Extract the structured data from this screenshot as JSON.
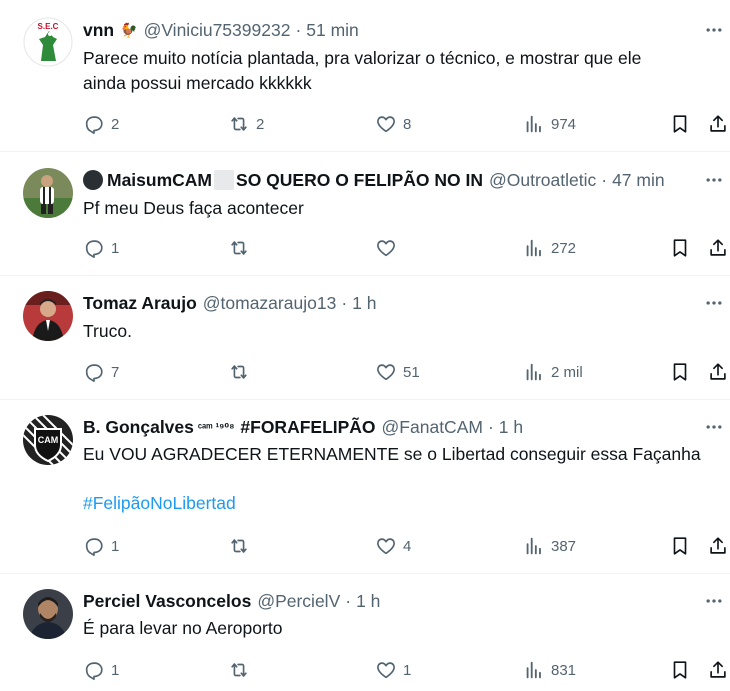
{
  "tweets": [
    {
      "name": "vnn",
      "handle": "@Viniciu75399232",
      "time": "51 min",
      "text": "Parece muito notícia plantada, pra valorizar o técnico, e mostrar que ele\nainda possui mercado kkkkkk",
      "counts": {
        "reply": "2",
        "retweet": "2",
        "like": "8",
        "views": "974"
      },
      "avatar_text": "S.E.C"
    },
    {
      "name": "MaisumCAM",
      "name_rest": "SO QUERO O FELIPÃO NO IN",
      "handle": "@Outroatletic",
      "time": "47 min",
      "text": "Pf meu Deus faça acontecer",
      "counts": {
        "reply": "1",
        "retweet": "",
        "like": "",
        "views": "272"
      }
    },
    {
      "name": "Tomaz Araujo",
      "handle": "@tomazaraujo13",
      "time": "1 h",
      "text": "Truco.",
      "counts": {
        "reply": "7",
        "retweet": "",
        "like": "51",
        "views": "2 mil"
      }
    },
    {
      "name": "B. Gonçalves",
      "name_sup": "ᶜᵃᵐ ¹⁹⁰⁸",
      "name_tag": "#FORAFELIPÃO",
      "handle": "@FanatCAM",
      "time": "1 h",
      "text": "Eu VOU AGRADECER ETERNAMENTE se o Libertad conseguir essa Façanha",
      "hashtag": "#FelipãoNoLibertad",
      "counts": {
        "reply": "1",
        "retweet": "",
        "like": "4",
        "views": "387"
      },
      "avatar_text": "CAM"
    },
    {
      "name": "Perciel Vasconcelos",
      "handle": "@PercielV",
      "time": "1 h",
      "text": "É para levar no Aeroporto",
      "counts": {
        "reply": "1",
        "retweet": "",
        "like": "1",
        "views": "831"
      }
    }
  ],
  "colors": {
    "text": "#0f1419",
    "muted": "#536471",
    "link": "#1d9bf0",
    "divider": "#eff3f4"
  },
  "icons": [
    "more-icon",
    "reply-icon",
    "retweet-icon",
    "like-icon",
    "views-icon",
    "bookmark-icon",
    "share-icon"
  ]
}
